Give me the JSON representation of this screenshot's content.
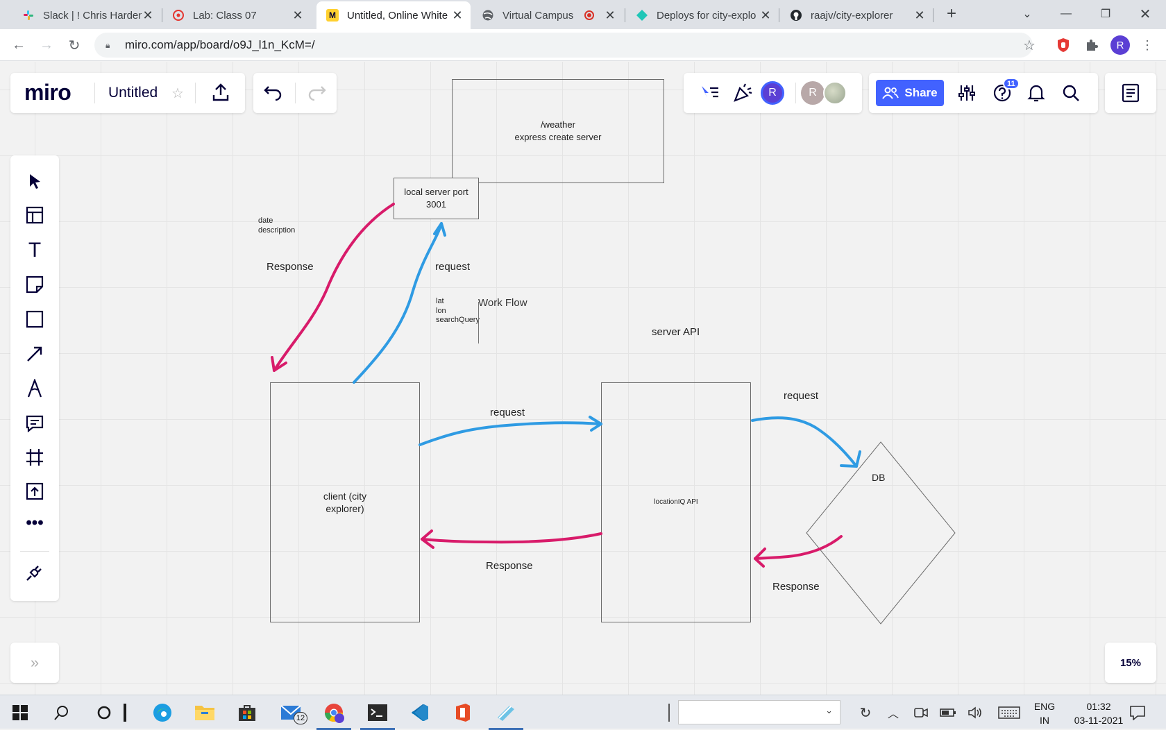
{
  "browser": {
    "tabs": [
      {
        "title": "Slack | ! Chris Harden",
        "icon": "slack-icon",
        "active": false
      },
      {
        "title": "Lab: Class 07",
        "icon": "canvas-icon",
        "active": false
      },
      {
        "title": "Untitled, Online White",
        "icon": "miro-icon",
        "active": true
      },
      {
        "title": "Virtual Campus",
        "icon": "globe-icon",
        "active": false
      },
      {
        "title": "Deploys for city-explo",
        "icon": "netlify-icon",
        "active": false
      },
      {
        "title": "raajv/city-explorer",
        "icon": "github-icon",
        "active": false
      }
    ],
    "new_tab_icon": "plus-icon",
    "url": "miro.com/app/board/o9J_l1n_KcM=/"
  },
  "miro": {
    "logo": "miro",
    "board_title": "Untitled",
    "share_label": "Share",
    "avatar_initial": "R",
    "notification_count": "11",
    "zoom": "15%",
    "collapse_label": "»"
  },
  "canvas": {
    "weather_box": {
      "line1": "/weather",
      "line2": "express create server"
    },
    "local_server": {
      "line1": "local server port",
      "line2": "3001"
    },
    "date_desc": {
      "line1": "date",
      "line2": "description"
    },
    "response_top": "Response",
    "request_top": "request",
    "query_params": {
      "line1": "lat",
      "line2": "lon",
      "line3": "searchQuery"
    },
    "workflow": "Work Flow",
    "server_api": "server API",
    "client_box": {
      "line1": "client (city",
      "line2": "explorer)"
    },
    "request_mid": "request",
    "response_mid": "Response",
    "location_box": "locationIQ API",
    "request_db": "request",
    "db": "DB",
    "response_db": "Response"
  },
  "taskbar": {
    "mail_badge": "12",
    "lang_line1": "ENG",
    "lang_line2": "IN",
    "time": "01:32",
    "date": "03-11-2021"
  },
  "colors": {
    "response_arrow": "#d81b6a",
    "request_arrow": "#2f9be3",
    "share_button": "#4262ff",
    "avatar": "#5b3fd4"
  }
}
